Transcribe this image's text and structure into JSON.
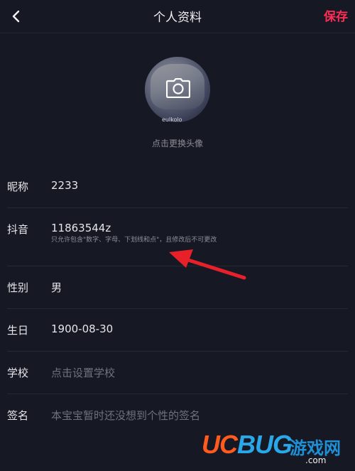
{
  "header": {
    "title": "个人资料",
    "save_label": "保存"
  },
  "avatar": {
    "caption": "eulkolo",
    "change_label": "点击更换头像"
  },
  "fields": {
    "nickname": {
      "label": "昵称",
      "value": "2233"
    },
    "douyin_id": {
      "label": "抖音",
      "value": "11863544z",
      "hint": "只允许包含\"数字、字母、下划线和点\"，且修改后不可更改"
    },
    "gender": {
      "label": "性别",
      "value": "男"
    },
    "birthday": {
      "label": "生日",
      "value": "1900-08-30"
    },
    "school": {
      "label": "学校",
      "placeholder": "点击设置学校"
    },
    "signature": {
      "label": "签名",
      "placeholder": "本宝宝暂时还没想到个性的签名"
    }
  },
  "watermark": {
    "logo_uc": "UC",
    "logo_bug": "BUG",
    "logo_cn": "游戏网",
    "site": ".com"
  },
  "colors": {
    "background": "#161823",
    "accent": "#ff2c55",
    "annotation_arrow": "#e8202a"
  },
  "icons": [
    "back-chevron-icon",
    "camera-icon",
    "annotation-arrow"
  ]
}
